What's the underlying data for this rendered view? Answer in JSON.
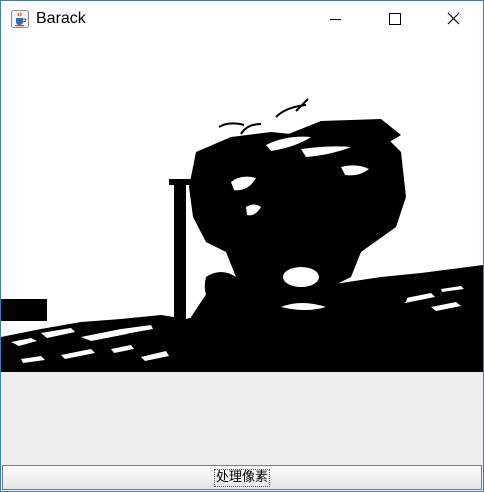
{
  "window": {
    "title": "Barack"
  },
  "icons": {
    "app": "java-cup-icon",
    "minimize": "minimize-icon",
    "maximize": "maximize-icon",
    "close": "close-icon"
  },
  "image_panel": {
    "description_kind": "binarized-photo",
    "colors": [
      "#000000",
      "#ffffff"
    ]
  },
  "button": {
    "label": "处理像素"
  },
  "colors": {
    "window_border": "#3c7fb1",
    "panel_background": "#eeeeee"
  }
}
